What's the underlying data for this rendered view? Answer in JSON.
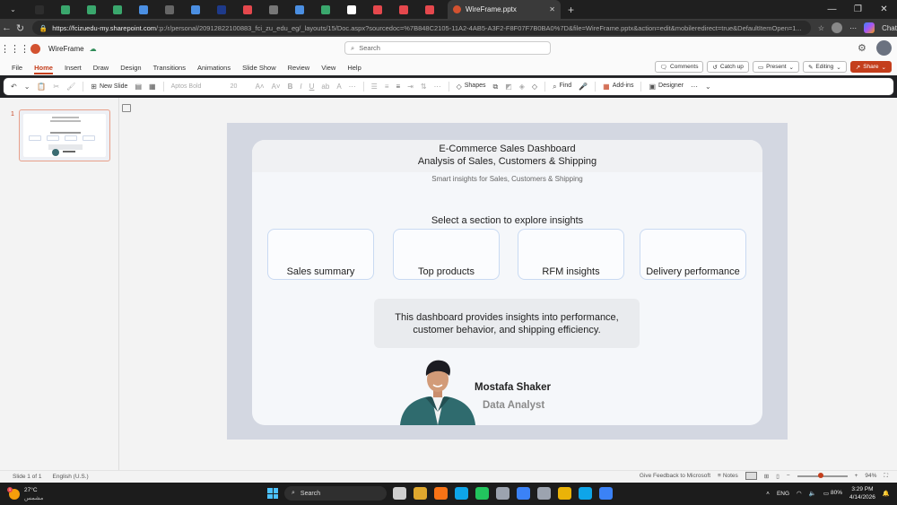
{
  "browser": {
    "active_tab_title": "WireFrame.pptx",
    "url_host": "https://fcizuedu-my.sharepoint.com",
    "url_rest": "/:p:/r/personal/20912822100883_fci_zu_edu_eg/_layouts/15/Doc.aspx?sourcedoc=%7B848C2105-11A2-4AB5-A3F2-F8F07F7B0BA0%7D&file=WireFrame.pptx&action=edit&mobileredirect=true&DefaultItemOpen=1...",
    "chat_label": "Chat",
    "tab_favicon_colors": [
      "#2d2d2d",
      "#3aa76d",
      "#3aa76d",
      "#3aa76d",
      "#4b8fe2",
      "#666666",
      "#4b8fe2",
      "#1e3a8a",
      "#e5484d",
      "#777777",
      "#4b8fe2",
      "#3aa76d",
      "#ffffff",
      "#e5484d",
      "#e5484d",
      "#e5484d"
    ]
  },
  "office": {
    "file_name": "WireFrame",
    "search_placeholder": "Search"
  },
  "ribbon": {
    "tabs": [
      "File",
      "Home",
      "Insert",
      "Draw",
      "Design",
      "Transitions",
      "Animations",
      "Slide Show",
      "Review",
      "View",
      "Help"
    ],
    "active_tab": "Home",
    "comments_label": "Comments",
    "catchup_label": "Catch up",
    "present_label": "Present",
    "editing_label": "Editing",
    "share_label": "Share",
    "new_slide_label": "New Slide",
    "font_name": "Aptos Bold",
    "font_size": "20",
    "shapes_label": "Shapes",
    "find_label": "Find",
    "addins_label": "Add-ins",
    "designer_label": "Designer"
  },
  "thumbnails": {
    "slide_number": "1"
  },
  "slide": {
    "title_line1": "E-Commerce Sales Dashboard",
    "title_line2": "Analysis of Sales, Customers & Shipping",
    "subtitle": "Smart insights for Sales, Customers & Shipping",
    "prompt": "Select a section to explore insights",
    "sections": [
      "Sales summary",
      "Top products",
      "RFM insights",
      "Delivery performance"
    ],
    "description_line1": "This dashboard provides insights into performance,",
    "description_line2": "customer behavior, and shipping efficiency.",
    "person_name": "Mostafa Shaker",
    "person_role": "Data Analyst"
  },
  "status": {
    "slide_count": "Slide 1 of 1",
    "language": "English (U.S.)",
    "feedback": "Give Feedback to Microsoft",
    "notes": "Notes",
    "zoom": "94%",
    "zoom_level": 0.94
  },
  "taskbar": {
    "temperature": "27°C",
    "weather_sub": "مشمس",
    "weather_badge": "1",
    "search_label": "Search",
    "lang": "ENG",
    "battery": "80%",
    "time": "3:29 PM",
    "date": "4/14/2026",
    "app_colors": [
      "#cfcfcf",
      "#e0a82e",
      "#f97316",
      "#0ea5e9",
      "#22c55e",
      "#9ca3af",
      "#3b82f6",
      "#9ca3af",
      "#eab308",
      "#0ea5e9",
      "#3b82f6"
    ]
  }
}
